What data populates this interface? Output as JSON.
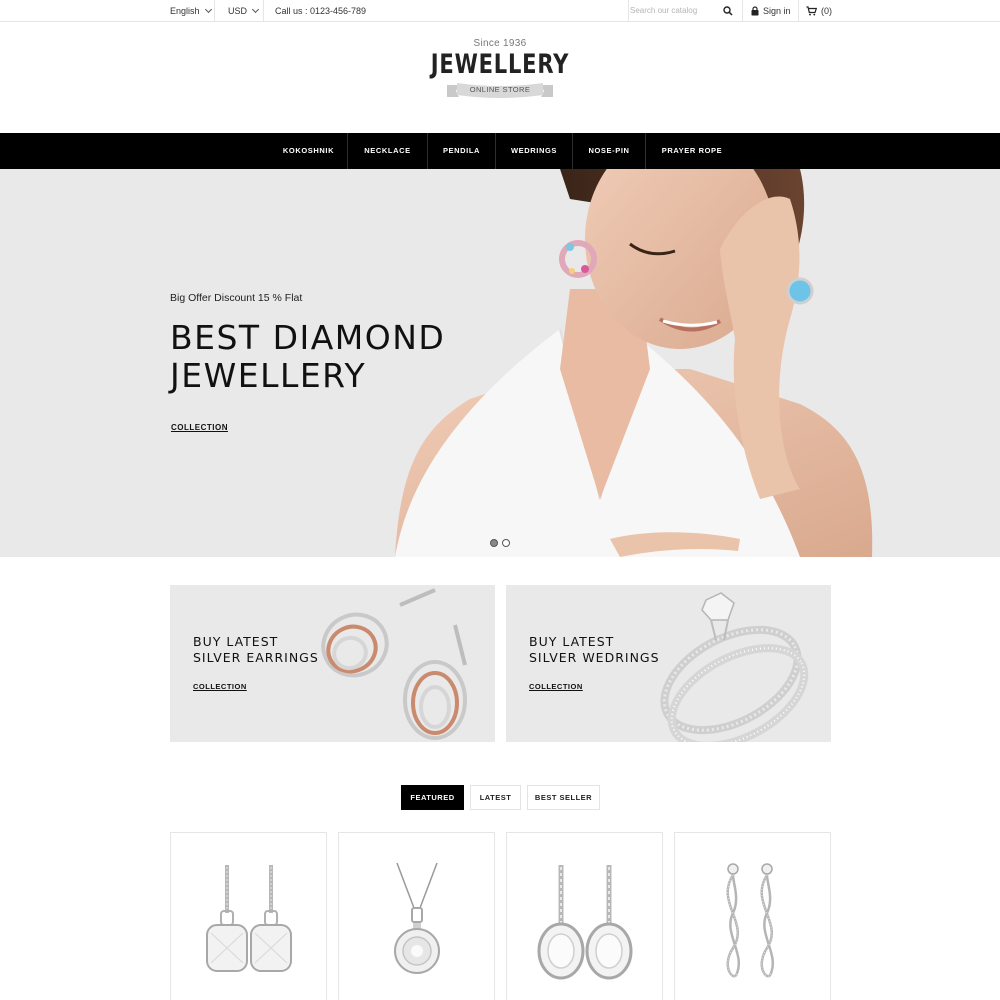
{
  "topbar": {
    "language": "English",
    "currency": "USD",
    "phone": "Call us : 0123-456-789",
    "search_placeholder": "Search our catalog",
    "sign_in": "Sign in",
    "cart_count": "(0)"
  },
  "logo": {
    "since": "Since 1936",
    "brand": "JEWELLERY",
    "tagline": "ONLINE STORE"
  },
  "nav": {
    "items": [
      "KOKOSHNIK",
      "NECKLACE",
      "PENDILA",
      "WEDRINGS",
      "NOSE-PIN",
      "PRAYER ROPE"
    ]
  },
  "hero": {
    "offer": "Big Offer Discount 15 % Flat",
    "title_line1": "BEST DIAMOND",
    "title_line2": "JEWELLERY",
    "link": "COLLECTION",
    "slide_count": 2,
    "active_slide": 1
  },
  "banners": [
    {
      "title_line1": "BUY LATEST",
      "title_line2": "SILVER EARRINGS",
      "link": "COLLECTION"
    },
    {
      "title_line1": "BUY LATEST",
      "title_line2": "SILVER WEDRINGS",
      "link": "COLLECTION"
    }
  ],
  "tabs": {
    "items": [
      "FEATURED",
      "LATEST",
      "BEST SELLER"
    ],
    "active": "FEATURED"
  },
  "products": [
    {
      "kind": "drop-earrings-cushion"
    },
    {
      "kind": "solitaire-pendant-necklace"
    },
    {
      "kind": "oval-halo-drop-earrings"
    },
    {
      "kind": "twisted-drop-earrings"
    }
  ],
  "colors": {
    "nav_bg": "#000000",
    "hero_bg": "#e9e9e9",
    "banner_bg": "#e9e9e9",
    "active_tab_bg": "#000000"
  }
}
